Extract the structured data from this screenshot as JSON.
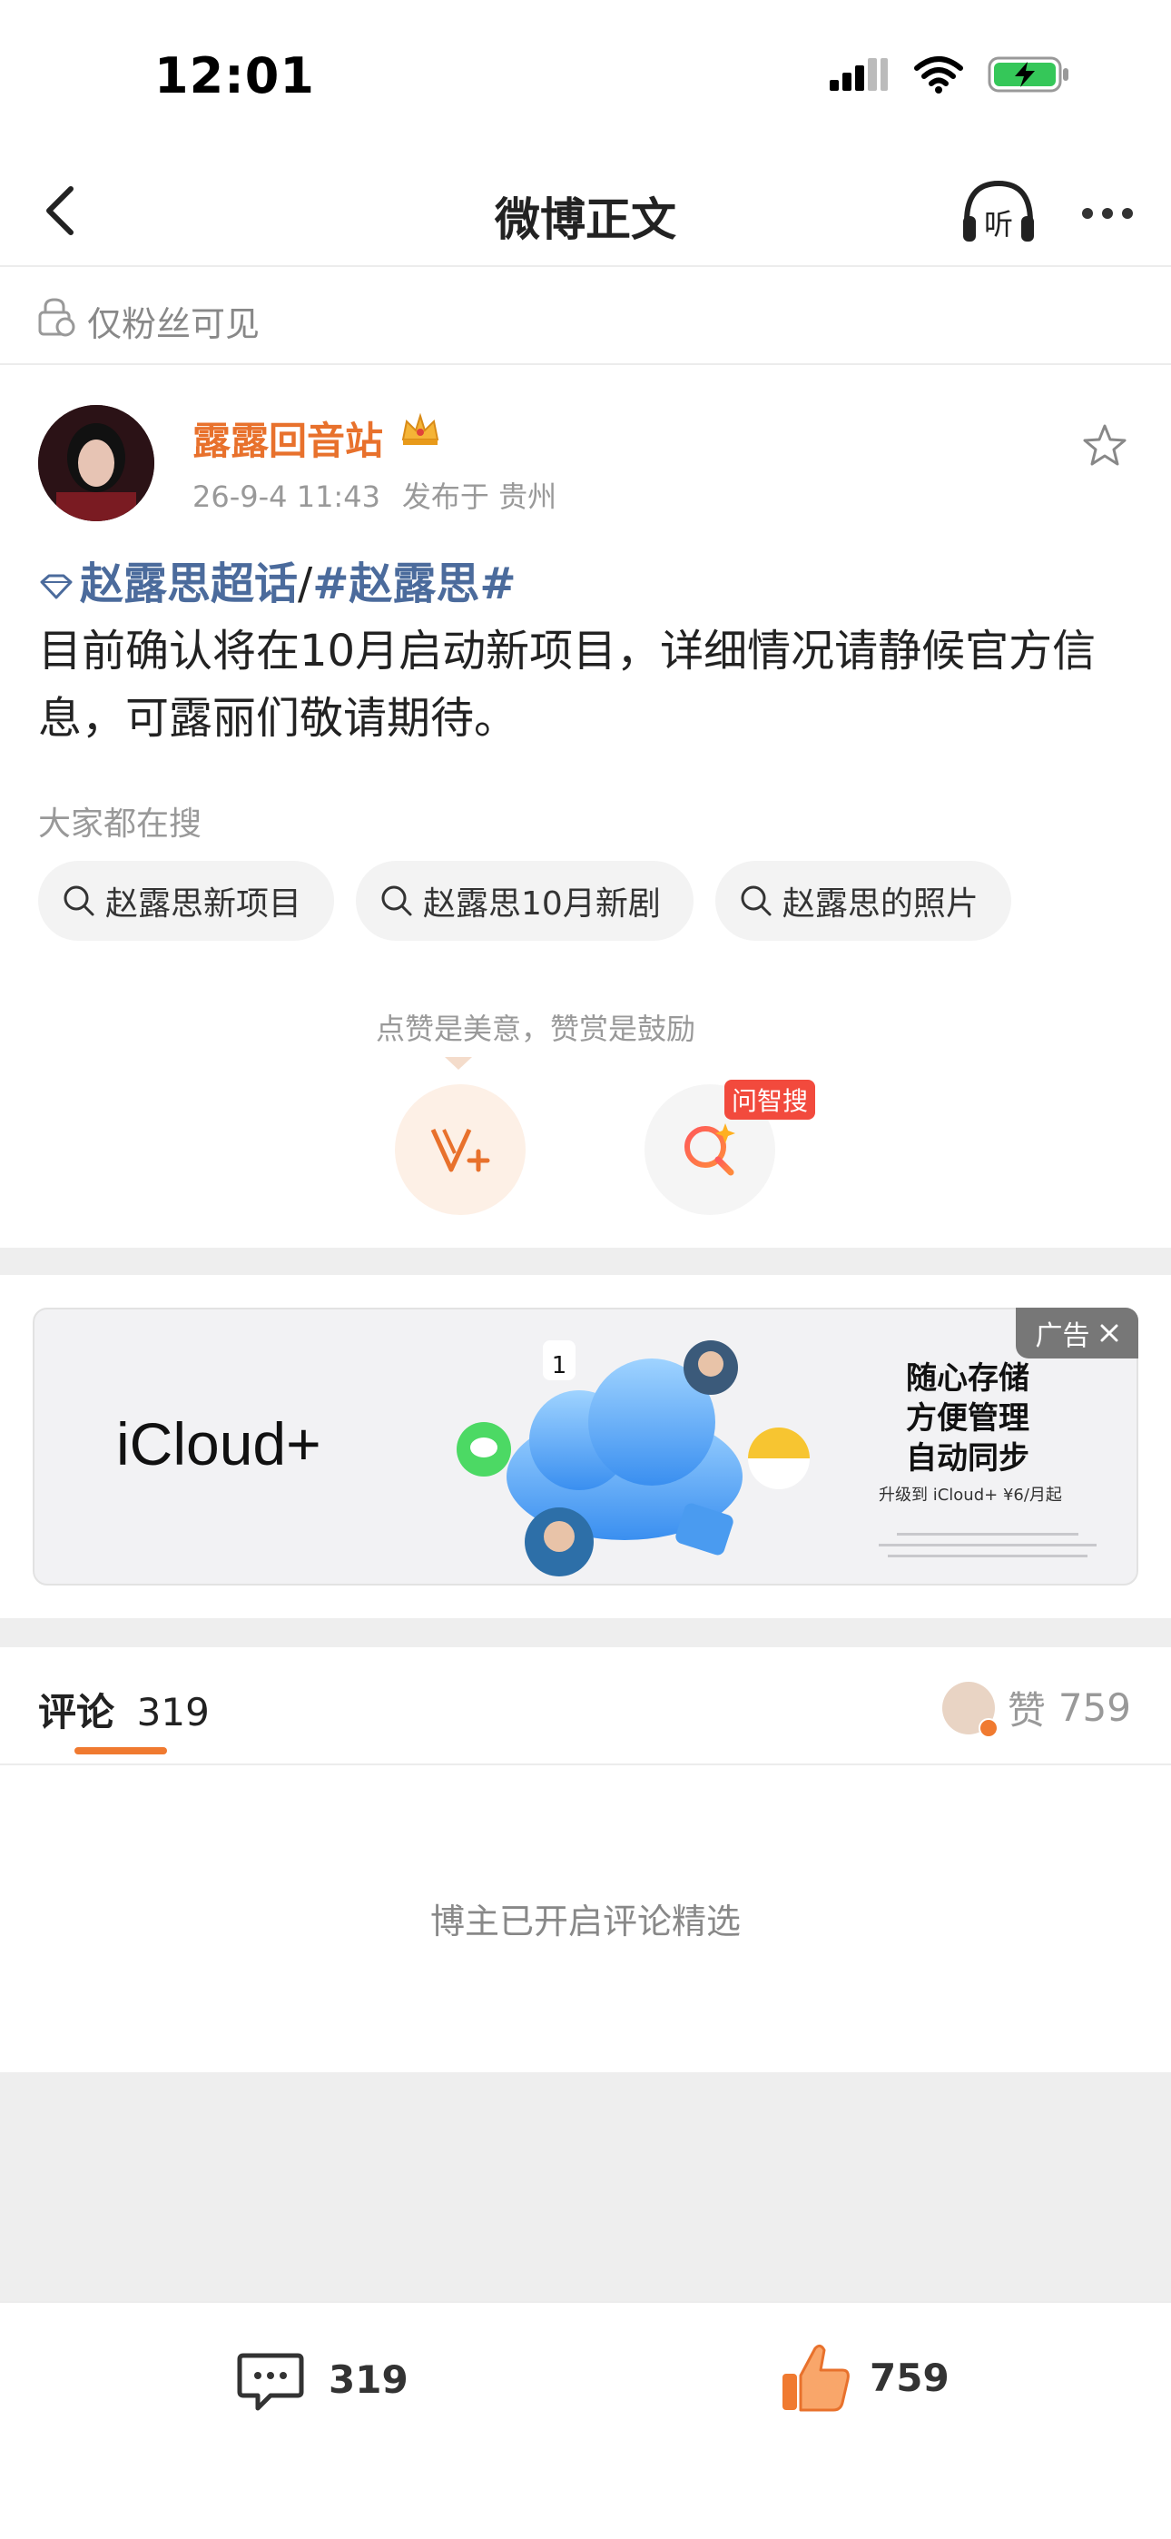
{
  "status_bar": {
    "time": "12:01"
  },
  "nav": {
    "title": "微博正文",
    "listen_label": "听"
  },
  "visibility": {
    "text": "仅粉丝可见"
  },
  "post": {
    "username": "露露回音站",
    "date": "26-9-4 11:43",
    "location": "发布于 贵州",
    "topic_supertopic": "赵露思超话",
    "topic_separator": "/",
    "topic_hashtag": "#赵露思#",
    "body": "目前确认将在10月启动新项目，详细情况请静候官方信息，可露丽们敬请期待。"
  },
  "search": {
    "label": "大家都在搜",
    "chips": [
      "赵露思新项目",
      "赵露思10月新剧",
      "赵露思的照片"
    ]
  },
  "reward": {
    "tip": "点赞是美意，赞赏是鼓励",
    "ai_badge": "问智搜"
  },
  "ad": {
    "tag": "广告",
    "brand": "iCloud+",
    "line1": "随心存储",
    "line2": "方便管理",
    "line3": "自动同步",
    "small": "升级到 iCloud+ ¥6/月起",
    "calendar_day": "1"
  },
  "comments": {
    "tab_label": "评论",
    "count": "319",
    "likes_label": "赞",
    "likes_count": "759",
    "featured_note": "博主已开启评论精选"
  },
  "bottom_bar": {
    "comment_count": "319",
    "like_count": "759"
  },
  "colors": {
    "accent": "#e8712c",
    "topic": "#4b6b9c",
    "badge": "#f24a3d",
    "band": "#eeeeee"
  }
}
